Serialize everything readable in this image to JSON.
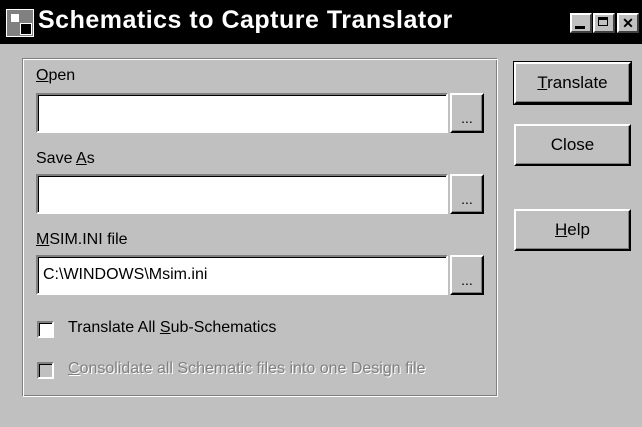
{
  "window": {
    "title": "Schematics to Capture Translator",
    "icon": "schematic-app-icon",
    "controls": {
      "minimize": "",
      "maximize": "",
      "close": "✕"
    }
  },
  "form": {
    "open": {
      "label_mnemonic": "O",
      "label_rest": "pen",
      "value": "",
      "browse_label": "..."
    },
    "save_as": {
      "label_pre": "Save ",
      "label_mnemonic": "A",
      "label_rest": "s",
      "value": "",
      "browse_label": "..."
    },
    "msim": {
      "label_mnemonic": "M",
      "label_rest": "SIM.INI file",
      "value": "C:\\WINDOWS\\Msim.ini",
      "browse_label": "..."
    },
    "translate_all": {
      "label_pre": "Translate All ",
      "label_mnemonic": "S",
      "label_rest": "ub-Schematics",
      "checked": false,
      "enabled": true
    },
    "consolidate": {
      "label_mnemonic": "C",
      "label_rest": "onsolidate all Schematic files into one Design file",
      "checked": false,
      "enabled": false
    }
  },
  "buttons": {
    "translate": {
      "mnemonic": "T",
      "rest": "ranslate"
    },
    "close": {
      "label": "Close"
    },
    "help": {
      "mnemonic": "H",
      "rest": "elp"
    }
  },
  "colors": {
    "face": "#c0c0c0",
    "titlebar": "#000000",
    "title_text": "#ffffff",
    "disabled_text": "#808080"
  }
}
